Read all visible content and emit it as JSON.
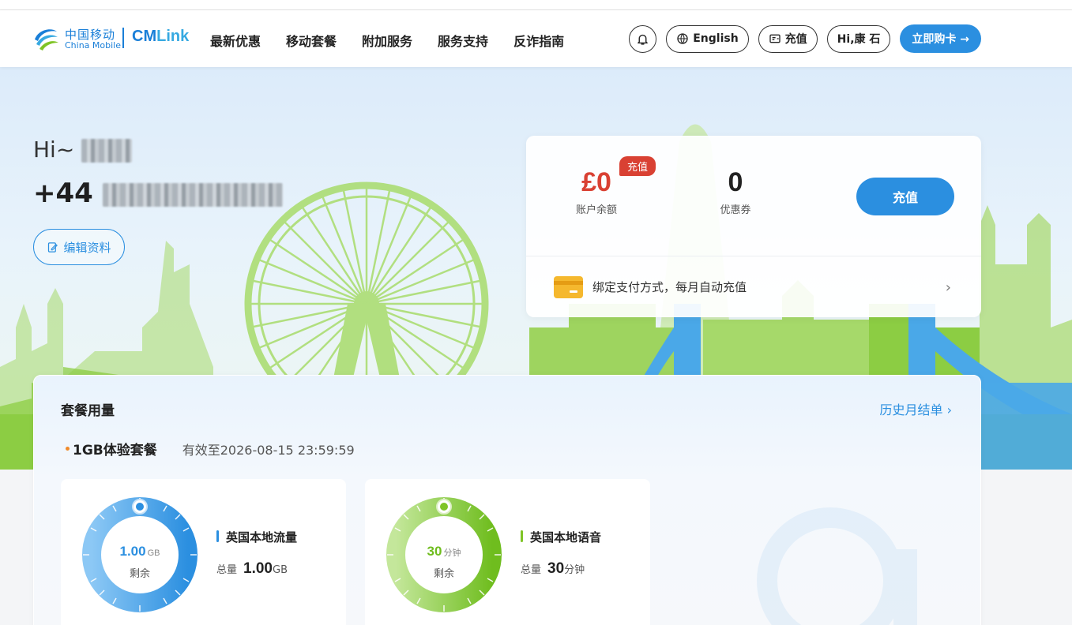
{
  "header": {
    "logo": {
      "cn": "中国移动",
      "en": "China Mobile",
      "brand_a": "CM",
      "brand_b": "Link"
    },
    "nav": [
      "最新优惠",
      "移动套餐",
      "附加服务",
      "服务支持",
      "反诈指南"
    ],
    "language_label": "English",
    "recharge_label": "充值",
    "user_label": "Hi,康 石",
    "buy_label": "立即购卡 →"
  },
  "profile": {
    "greeting": "Hi~",
    "country_code": "+44",
    "edit_label": "编辑资料"
  },
  "wallet": {
    "balance": "£0",
    "balance_label": "账户余额",
    "recharge_tag": "充值",
    "coupons": "0",
    "coupons_label": "优惠券",
    "recharge_button": "充值",
    "bind_text": "绑定支付方式，每月自动充值",
    "bind_chevron": "›"
  },
  "usage": {
    "title": "套餐用量",
    "history_link": "历史月结单 ›",
    "plan_name": "1GB体验套餐",
    "plan_valid": "有效至2026-08-15 23:59:59",
    "cards": [
      {
        "name": "英国本地流量",
        "remaining": "1.00",
        "unit": "GB",
        "remaining_label": "剩余",
        "total_label": "总量",
        "total": "1.00",
        "total_unit": "GB",
        "color": "#2b8fe0",
        "fraction_remaining": 1.0
      },
      {
        "name": "英国本地语音",
        "remaining": "30",
        "unit": "分钟",
        "remaining_label": "剩余",
        "total_label": "总量",
        "total": "30",
        "total_unit": "分钟",
        "color": "#7fc426",
        "fraction_remaining": 1.0
      }
    ]
  },
  "colors": {
    "accent": "#2b8fe0",
    "balance_red": "#d94133",
    "voice_green": "#7fc426"
  }
}
